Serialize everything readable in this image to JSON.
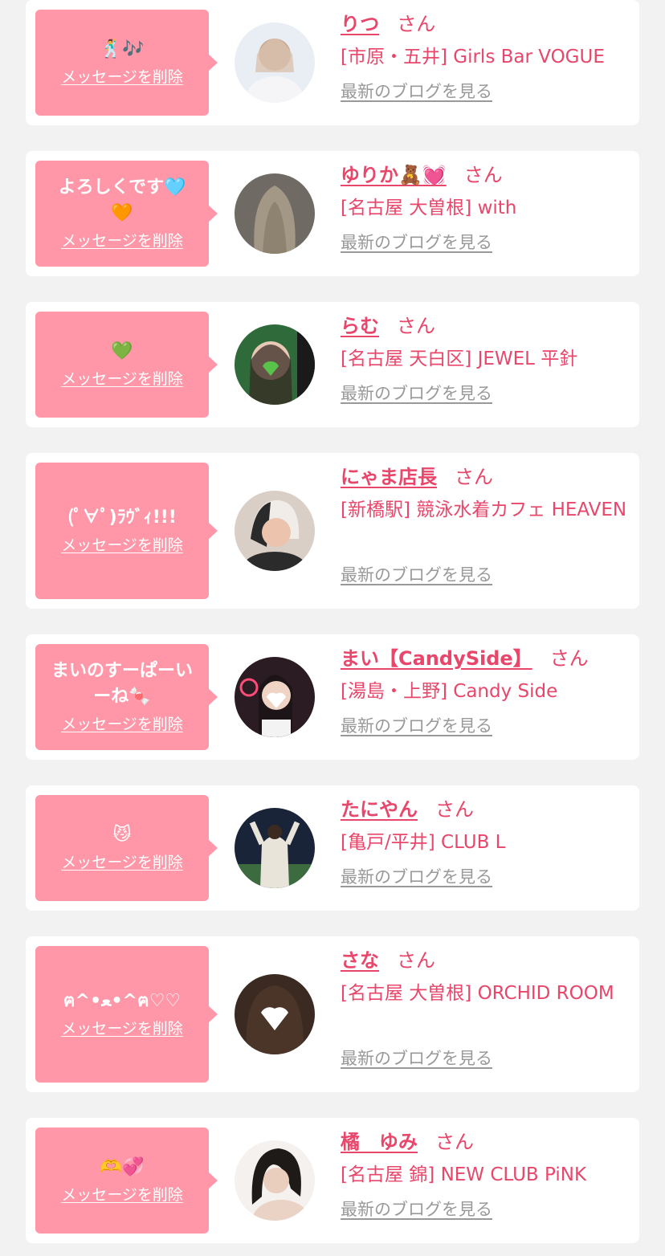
{
  "delete_label": "メッセージを削除",
  "blog_label": "最新のブログを見る",
  "honorific": "さん",
  "entries": [
    {
      "message": "🕺🎶",
      "name": "りつ",
      "shop": "[市原・五井] Girls Bar VOGUE"
    },
    {
      "message": "よろしくです🩵🧡",
      "name": "ゆりか🧸💓",
      "shop": "[名古屋 大曽根] with"
    },
    {
      "message": "💚",
      "name": "らむ",
      "shop": "[名古屋 天白区] JEWEL 平針"
    },
    {
      "message": "(ﾟ∀ﾟ)ﾗｳﾞｨ!!!",
      "name": "にゃま店長",
      "shop": "[新橋駅] 競泳水着カフェ HEAVEN"
    },
    {
      "message": "まいのすーぱーいーね🍬",
      "name": "まい【CandySide】",
      "shop": "[湯島・上野] Candy Side"
    },
    {
      "message": "😼",
      "name": "たにやん",
      "shop": "[亀戸/平井] CLUB L"
    },
    {
      "message": "ฅ^•ﻌ•^ฅ♡♡",
      "name": "さな",
      "shop": "[名古屋 大曽根] ORCHID ROOM"
    },
    {
      "message": "🫶💞",
      "name": "橘　ゆみ",
      "shop": "[名古屋 錦] NEW CLUB PiNK"
    }
  ],
  "colors": {
    "bubble": "#ff97a8",
    "accent": "#e8476b",
    "link_gray": "#999999",
    "page_bg": "#f2f2f2"
  }
}
